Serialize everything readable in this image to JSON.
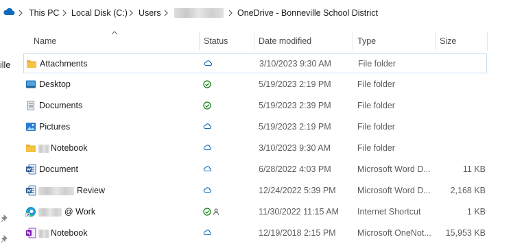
{
  "breadcrumb": {
    "items": [
      "This PC",
      "Local Disk (C:)",
      "Users",
      "OneDrive - Bonneville School District"
    ]
  },
  "nav": {
    "partial_label": "ille"
  },
  "columns": {
    "name": "Name",
    "status": "Status",
    "date": "Date modified",
    "type": "Type",
    "size": "Size"
  },
  "rows": [
    {
      "name": "Attachments",
      "status": "cloud-icon",
      "date": "3/10/2023 9:30 AM",
      "type": "File folder",
      "size": ""
    },
    {
      "name": "Desktop",
      "status": "synced-check-icon",
      "date": "5/19/2023 2:19 PM",
      "type": "File folder",
      "size": ""
    },
    {
      "name": "Documents",
      "status": "synced-check-icon",
      "date": "5/19/2023 2:39 PM",
      "type": "File folder",
      "size": ""
    },
    {
      "name": "Pictures",
      "status": "cloud-icon",
      "date": "5/19/2023 2:19 PM",
      "type": "File folder",
      "size": ""
    },
    {
      "name": "Notebook",
      "status": "cloud-icon",
      "date": "3/10/2023 9:30 AM",
      "type": "File folder",
      "size": ""
    },
    {
      "name": "Document",
      "status": "cloud-icon",
      "date": "6/28/2022 4:03 PM",
      "type": "Microsoft Word D...",
      "size": "11 KB"
    },
    {
      "name": "Review",
      "status": "cloud-icon",
      "date": "12/24/2022 5:39 PM",
      "type": "Microsoft Word D...",
      "size": "2,168 KB"
    },
    {
      "name": "@ Work",
      "status": "synced-shared-icon",
      "date": "11/30/2022 11:15 AM",
      "type": "Internet Shortcut",
      "size": "1 KB"
    },
    {
      "name": "Notebook",
      "status": "cloud-icon",
      "date": "12/19/2018 2:15 PM",
      "type": "Microsoft OneNot...",
      "size": "15,953 KB"
    }
  ],
  "colors": {
    "accent": "#0f6cbd",
    "synced_green": "#107c10",
    "folder_yellow": "#f6c342",
    "selection_border": "#c5def5"
  }
}
